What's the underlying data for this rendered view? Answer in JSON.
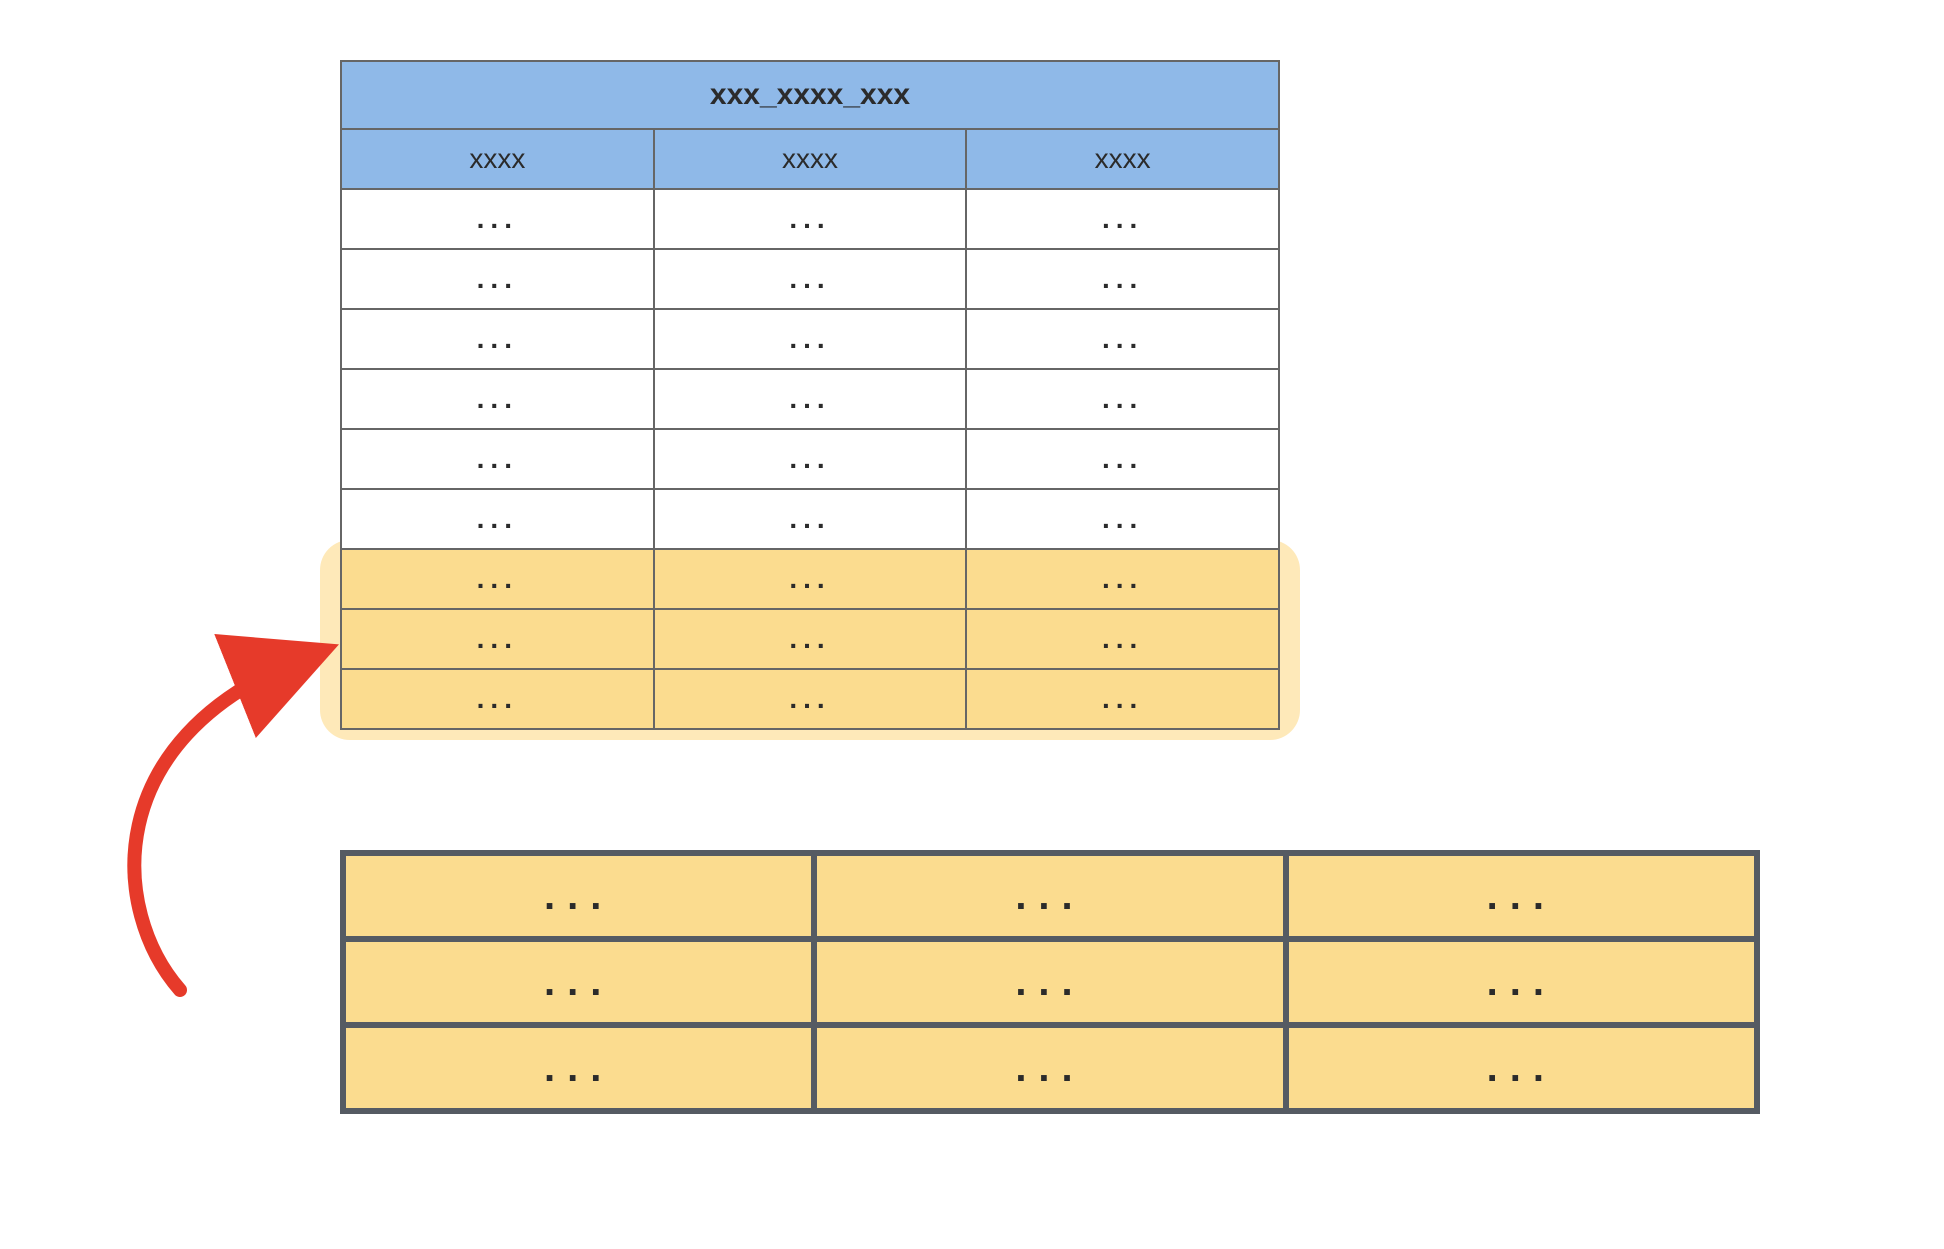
{
  "diagram": {
    "top_table": {
      "title": "xxx_xxxx_xxx",
      "columns": [
        "xxxx",
        "xxxx",
        "xxxx"
      ],
      "rows": [
        {
          "cells": [
            "...",
            "...",
            "..."
          ],
          "highlighted": false
        },
        {
          "cells": [
            "...",
            "...",
            "..."
          ],
          "highlighted": false
        },
        {
          "cells": [
            "...",
            "...",
            "..."
          ],
          "highlighted": false
        },
        {
          "cells": [
            "...",
            "...",
            "..."
          ],
          "highlighted": false
        },
        {
          "cells": [
            "...",
            "...",
            "..."
          ],
          "highlighted": false
        },
        {
          "cells": [
            "...",
            "...",
            "..."
          ],
          "highlighted": false
        },
        {
          "cells": [
            "...",
            "...",
            "..."
          ],
          "highlighted": true
        },
        {
          "cells": [
            "...",
            "...",
            "..."
          ],
          "highlighted": true
        },
        {
          "cells": [
            "...",
            "...",
            "..."
          ],
          "highlighted": true
        }
      ]
    },
    "bottom_grid": {
      "rows": [
        {
          "cells": [
            "...",
            "...",
            "..."
          ]
        },
        {
          "cells": [
            "...",
            "...",
            "..."
          ]
        },
        {
          "cells": [
            "...",
            "...",
            "..."
          ]
        }
      ]
    },
    "colors": {
      "header_blue": "#8fb9e8",
      "highlight_yellow": "#fbdc8f",
      "halo_yellow": "#fee9b9",
      "arrow_red": "#e63a2a",
      "border_gray": "#666",
      "thick_border_gray": "#555b63"
    },
    "arrow": {
      "from": "bottom_grid",
      "to": "top_table_highlighted_rows"
    }
  }
}
